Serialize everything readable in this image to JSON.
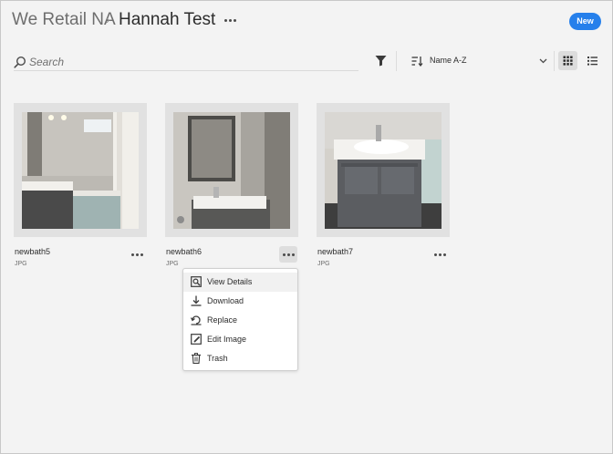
{
  "header": {
    "root_crumb": "We Retail NA",
    "separator": "›",
    "current_crumb": "Hannah Test",
    "more_icon": "ellipsis-icon",
    "new_label": "New"
  },
  "toolbar": {
    "search_placeholder": "Search",
    "filter_icon": "filter-icon",
    "sort_label": "Name A-Z",
    "sort_icon": "sort-icon",
    "grid_icon": "grid-view-icon",
    "list_icon": "list-view-icon"
  },
  "assets": [
    {
      "name": "newbath5",
      "type": "JPG"
    },
    {
      "name": "newbath6",
      "type": "JPG"
    },
    {
      "name": "newbath7",
      "type": "JPG"
    }
  ],
  "context_menu": {
    "items": [
      {
        "label": "View Details",
        "icon": "view-details-icon"
      },
      {
        "label": "Download",
        "icon": "download-icon"
      },
      {
        "label": "Replace",
        "icon": "replace-icon"
      },
      {
        "label": "Edit Image",
        "icon": "edit-image-icon"
      },
      {
        "label": "Trash",
        "icon": "trash-icon"
      }
    ]
  },
  "colors": {
    "accent": "#2680eb",
    "background": "#f3f3f3",
    "selected": "#dcdcdc"
  }
}
